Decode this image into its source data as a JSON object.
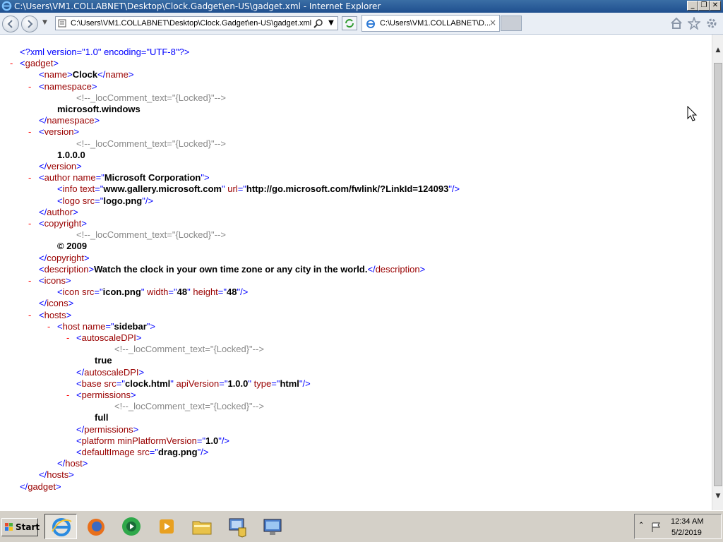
{
  "window": {
    "title": "C:\\Users\\VM1.COLLABNET\\Desktop\\Clock.Gadget\\en-US\\gadget.xml - Internet Explorer",
    "minimize_icon": "minimize-icon",
    "restore_icon": "restore-icon",
    "close_icon": "close-icon"
  },
  "toolbar": {
    "address": "C:\\Users\\VM1.COLLABNET\\Desktop\\Clock.Gadget\\en-US\\gadget.xml",
    "tab_label": "C:\\Users\\VM1.COLLABNET\\D...",
    "tab_close": "×",
    "dropdown_arrow": "▼"
  },
  "xml": {
    "pi": "<?xml version=\"1.0\" encoding=\"UTF-8\"?>",
    "minus": "-",
    "gadget_open": "gadget",
    "name_tag": "name",
    "name_value": "Clock",
    "namespace_tag": "namespace",
    "comment": "<!--_locComment_text=\"{Locked}\"-->",
    "namespace_value": "microsoft.windows",
    "version_tag": "version",
    "version_value": "1.0.0.0",
    "author_tag": "author",
    "name_attr": "name",
    "author_name": "Microsoft Corporation",
    "info_tag": "info",
    "text_attr": "text",
    "info_text": "www.gallery.microsoft.com",
    "url_attr": "url",
    "info_url": "http://go.microsoft.com/fwlink/?LinkId=124093",
    "logo_tag": "logo",
    "src_attr": "src",
    "logo_src": "logo.png",
    "copyright_tag": "copyright",
    "copyright_value": "© 2009",
    "description_tag": "description",
    "description_value": "Watch the clock in your own time zone or any city in the world.",
    "icons_tag": "icons",
    "icon_tag": "icon",
    "icon_src": "icon.png",
    "width_attr": "width",
    "icon_width": "48",
    "height_attr": "height",
    "icon_height": "48",
    "hosts_tag": "hosts",
    "host_tag": "host",
    "host_name": "sidebar",
    "autoscale_tag": "autoscaleDPI",
    "autoscale_value": "true",
    "base_tag": "base",
    "base_src": "clock.html",
    "apiversion_attr": "apiVersion",
    "base_api": "1.0.0",
    "type_attr": "type",
    "base_type": "html",
    "permissions_tag": "permissions",
    "permissions_value": "full",
    "platform_tag": "platform",
    "minplatform_attr": "minPlatformVersion",
    "platform_version": "1.0",
    "defaultimage_tag": "defaultImage",
    "defaultimage_src": "drag.png"
  },
  "taskbar": {
    "start_label": "Start",
    "apps": [
      "internet-explorer",
      "firefox",
      "media-center",
      "media-player",
      "file-explorer",
      "server-manager",
      "remote-desktop"
    ],
    "time": "12:34 AM",
    "date": "5/2/2019"
  }
}
